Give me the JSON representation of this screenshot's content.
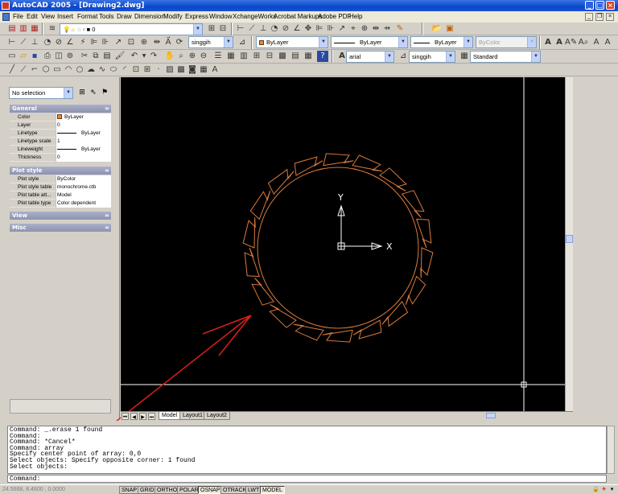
{
  "window": {
    "title": "AutoCAD 2005 - [Drawing2.dwg]"
  },
  "menu": [
    "File",
    "Edit",
    "View",
    "Insert",
    "Format",
    "Tools",
    "Draw",
    "Dimension",
    "Modify",
    "Express",
    "Window",
    "XchangeWorks",
    "Acrobat Markups",
    "Adobe PDF",
    "Help"
  ],
  "layers": {
    "current_layer": "0",
    "dimstyle": "singgih"
  },
  "properties_toolbar": {
    "color": "ByLayer",
    "linetype": "ByLayer",
    "lineweight": "ByLayer",
    "plotstyle": "ByColor"
  },
  "styles_toolbar": {
    "text_style": "arial",
    "dim_style": "singgih",
    "table_style": "Standard"
  },
  "properties_palette": {
    "selection": "No selection",
    "sections": {
      "general": "General",
      "plot_style": "Plot style",
      "view": "View",
      "misc": "Misc"
    },
    "general_rows": [
      {
        "name": "Color",
        "value": "ByLayer"
      },
      {
        "name": "Layer",
        "value": "0"
      },
      {
        "name": "Linetype",
        "value": "ByLayer"
      },
      {
        "name": "Linetype scale",
        "value": "1"
      },
      {
        "name": "Lineweight",
        "value": "ByLayer"
      },
      {
        "name": "Thickness",
        "value": "0"
      }
    ],
    "plot_rows": [
      {
        "name": "Plot style",
        "value": "ByColor"
      },
      {
        "name": "Plot style table",
        "value": "monochrome.ctb"
      },
      {
        "name": "Plot table att...",
        "value": "Model"
      },
      {
        "name": "Plot table type",
        "value": "Color dependent"
      }
    ]
  },
  "drawing": {
    "ucs_y_label": "Y",
    "ucs_x_label": "X",
    "object_color": "#d97a3c",
    "annotation_color": "#dd1e1e",
    "crosshair_color": "#ffffff",
    "vane_count": 18
  },
  "layout_tabs": [
    "Model",
    "Layout1",
    "Layout2"
  ],
  "active_tab": "Model",
  "command_history": [
    "Command: _.erase 1 found",
    "Command:",
    "Command: *Cancel*",
    "Command: array",
    "Specify center point of array: 0,0",
    "Select objects: Specify opposite corner: 1 found",
    "Select objects:"
  ],
  "command_prompt": "Command:",
  "status": {
    "coordinates": "24.5668, 8.4800 , 0.0000",
    "toggles": [
      {
        "label": "SNAP",
        "on": false
      },
      {
        "label": "GRID",
        "on": false
      },
      {
        "label": "ORTHO",
        "on": false
      },
      {
        "label": "POLAR",
        "on": false
      },
      {
        "label": "OSNAP",
        "on": true
      },
      {
        "label": "OTRACK",
        "on": false
      },
      {
        "label": "LWT",
        "on": false
      },
      {
        "label": "MODEL",
        "on": true
      }
    ]
  }
}
